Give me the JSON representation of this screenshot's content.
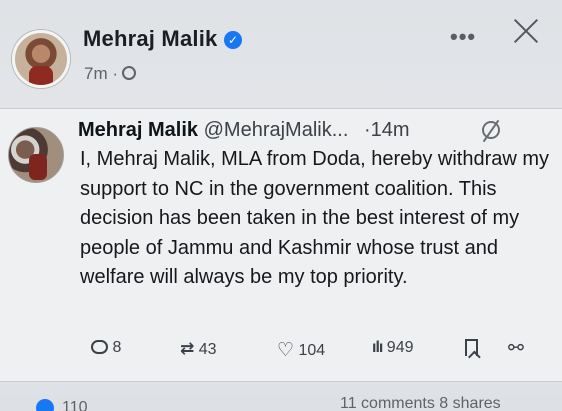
{
  "post": {
    "author": "Mehraj Malik",
    "time": "7m ·",
    "more_label": "•••"
  },
  "tweet": {
    "name": "Mehraj Malik",
    "handle": "@MehrajMalik...",
    "time": "·14m",
    "text": "I, Mehraj Malik, MLA from Doda, hereby withdraw my support to NC in the government coalition. This decision has been taken in the best interest of my people of Jammu and Kashmir whose trust and welfare will always be my top priority.",
    "replies": "8",
    "reposts": "43",
    "likes": "104",
    "views": "949"
  },
  "footer": {
    "reactions": "110",
    "stats": "11 comments  8 shares"
  },
  "icons": {
    "verified": "verified-badge-icon",
    "globe": "globe-icon",
    "close": "close-icon",
    "reply": "reply-icon",
    "repost": "repost-icon",
    "like": "heart-icon",
    "views": "views-icon",
    "bookmark": "bookmark-icon",
    "share": "share-icon"
  },
  "colors": {
    "accent": "#1877f2",
    "text": "#0f1419",
    "muted": "#5f6368"
  }
}
